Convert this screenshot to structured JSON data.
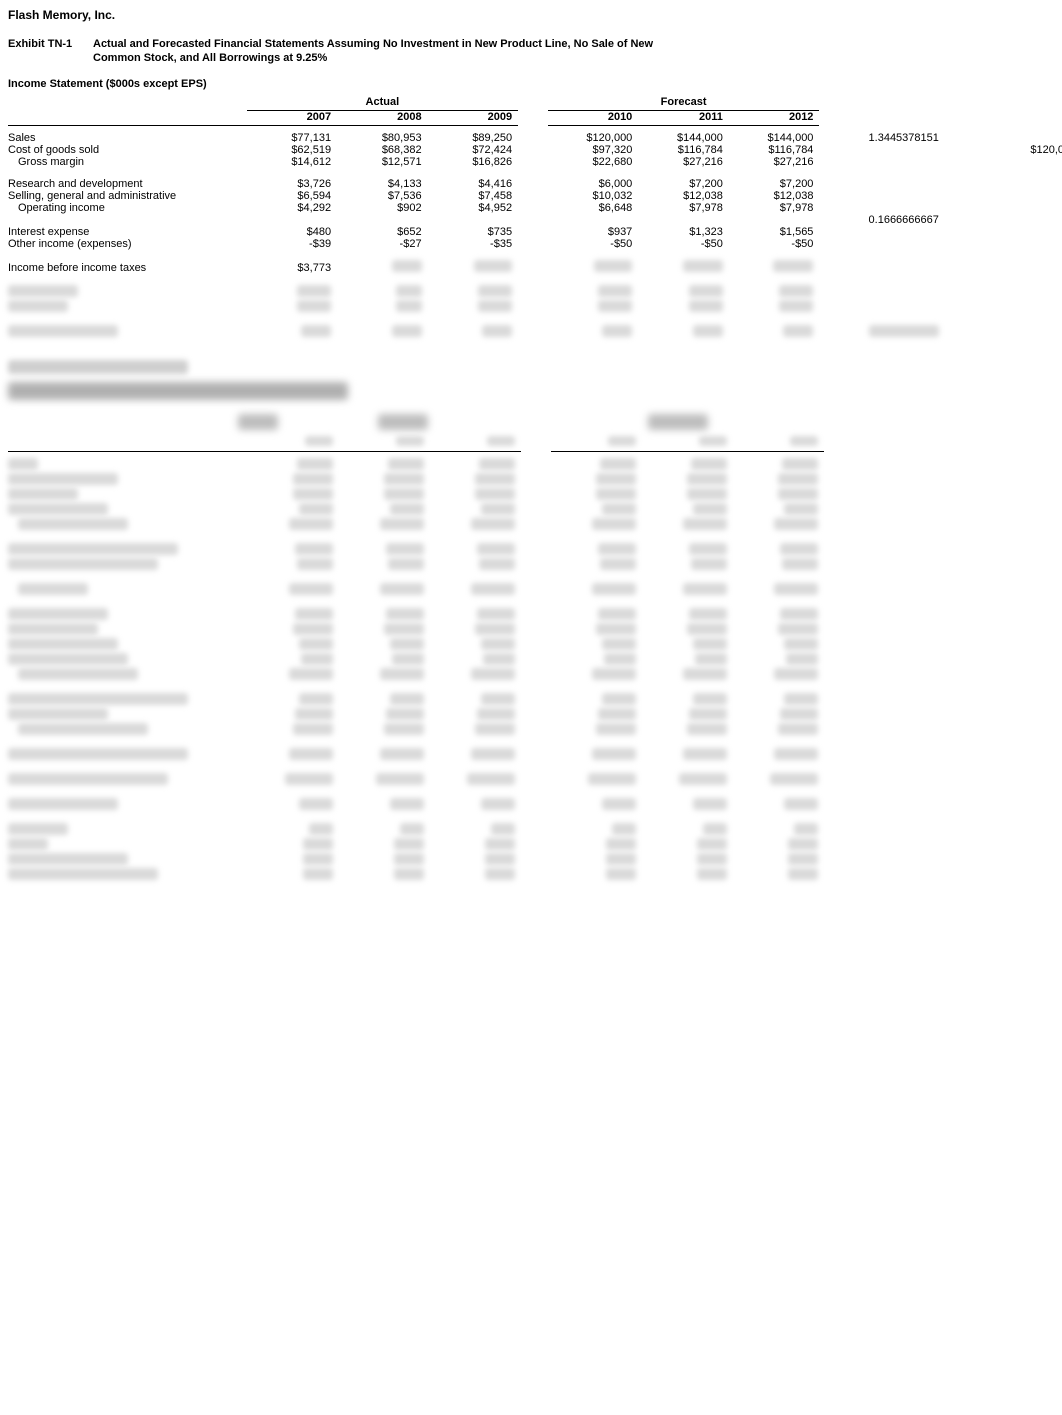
{
  "company": "Flash Memory, Inc.",
  "exhibit_label": "Exhibit TN-1",
  "exhibit_title": "Actual and Forecasted Financial Statements Assuming No Investment in New Product Line, No Sale of New",
  "exhibit_sub": "Common Stock, and All Borrowings at 9.25%",
  "is_title": "Income Statement ($000s except EPS)",
  "group_actual": "Actual",
  "group_forecast": "Forecast",
  "years": {
    "y2007": "2007",
    "y2008": "2008",
    "y2009": "2009",
    "y2010": "2010",
    "y2011": "2011",
    "y2012": "2012"
  },
  "rows": {
    "sales": {
      "label": "Sales",
      "y2007": "$77,131",
      "y2008": "$80,953",
      "y2009": "$89,250",
      "y2010": "$120,000",
      "y2011": "$144,000",
      "y2012": "$144,000"
    },
    "cogs": {
      "label": "Cost of goods sold",
      "y2007": "$62,519",
      "y2008": "$68,382",
      "y2009": "$72,424",
      "y2010": "$97,320",
      "y2011": "$116,784",
      "y2012": "$116,784"
    },
    "gross": {
      "label": "Gross margin",
      "y2007": "$14,612",
      "y2008": "$12,571",
      "y2009": "$16,826",
      "y2010": "$22,680",
      "y2011": "$27,216",
      "y2012": "$27,216"
    },
    "rd": {
      "label": "Research and development",
      "y2007": "$3,726",
      "y2008": "$4,133",
      "y2009": "$4,416",
      "y2010": "$6,000",
      "y2011": "$7,200",
      "y2012": "$7,200"
    },
    "sga": {
      "label": "Selling, general and administrative",
      "y2007": "$6,594",
      "y2008": "$7,536",
      "y2009": "$7,458",
      "y2010": "$10,032",
      "y2011": "$12,038",
      "y2012": "$12,038"
    },
    "opincome": {
      "label": "Operating income",
      "y2007": "$4,292",
      "y2008": "$902",
      "y2009": "$4,952",
      "y2010": "$6,648",
      "y2011": "$7,978",
      "y2012": "$7,978"
    },
    "intexp": {
      "label": "Interest expense",
      "y2007": "$480",
      "y2008": "$652",
      "y2009": "$735",
      "y2010": "$937",
      "y2011": "$1,323",
      "y2012": "$1,565"
    },
    "other": {
      "label": "Other income (expenses)",
      "y2007": "-$39",
      "y2008": "-$27",
      "y2009": "-$35",
      "y2010": "-$50",
      "y2011": "-$50",
      "y2012": "-$50"
    },
    "ibt": {
      "label": "Income before income taxes",
      "y2007": "$3,773"
    }
  },
  "side": {
    "val1": "1.3445378151",
    "val2": "$120,0",
    "val3": "0.1666666667"
  }
}
